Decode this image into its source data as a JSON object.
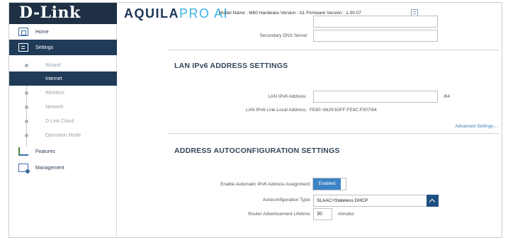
{
  "header": {
    "logo": "D-Link",
    "brand_part1": "AQUILA",
    "brand_part2": "PRO AI",
    "model_info": "Model Name : M60 Hardware Version : A1 Firmware Version : 1.00.07"
  },
  "sidebar": {
    "home": "Home",
    "settings": "Settings",
    "sub_items": [
      "Wizard",
      "Internet",
      "Wireless",
      "Network",
      "D-Link Cloud",
      "Operation Mode"
    ],
    "features": "Features",
    "management": "Management"
  },
  "main": {
    "secondary_dns_label": "Secondary DNS Server",
    "secondary_dns_value": "",
    "lan_ipv6_title": "LAN IPv6 ADDRESS SETTINGS",
    "lan_ipv6_address_label": "LAN IPv6 Address:",
    "lan_ipv6_address_value": "",
    "lan_ipv6_suffix": "/64",
    "link_local_label": "LAN IPv6 Link-Local Address:",
    "link_local_value": "FE80::6629:63FF:FE9C:F007/64",
    "advanced_link": "Advanced Settings...",
    "autoconfig_title": "ADDRESS AUTOCONFIGURATION SETTINGS",
    "enable_assign_label": "Enable Automatic IPv6 Address Assignment:",
    "enable_assign_value": "Enabled",
    "autoconfig_type_label": "Autoconfiguration Type:",
    "autoconfig_type_value": "SLAAC+Stateless DHCP",
    "router_adv_label": "Router Advertisement Lifetime:",
    "router_adv_value": "30",
    "router_adv_unit": "minutes"
  }
}
